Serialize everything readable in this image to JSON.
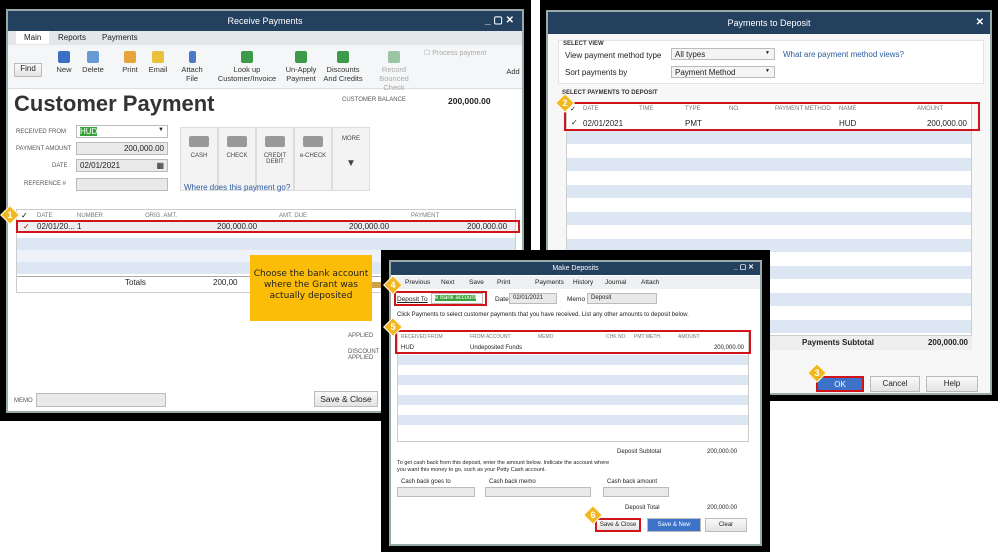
{
  "receive_payments": {
    "title": "Receive Payments",
    "tabs": [
      "Main",
      "Reports",
      "Payments"
    ],
    "toolbar": {
      "find": "Find",
      "new": "New",
      "delete": "Delete",
      "print": "Print",
      "email": "Email",
      "attach": "Attach File",
      "lookup": "Look up Customer/Invoice",
      "unapply": "Un-Apply Payment",
      "discounts": "Discounts And Credits",
      "record_bounced": "Record Bounced Check",
      "process_payment": "Process payment",
      "add": "Add"
    },
    "heading": "Customer Payment",
    "customer_balance_label": "CUSTOMER BALANCE",
    "customer_balance": "200,000.00",
    "received_from_label": "RECEIVED FROM",
    "received_from": "HUD",
    "payment_amount_label": "PAYMENT AMOUNT",
    "payment_amount": "200,000.00",
    "date_label": "DATE",
    "date": "02/01/2021",
    "reference_label": "REFERENCE #",
    "methods": [
      "CASH",
      "CHECK",
      "CREDIT DEBIT",
      "e-CHECK",
      "MORE"
    ],
    "where_link": "Where does this payment go?",
    "columns": [
      "✓",
      "DATE",
      "NUMBER",
      "ORIG. AMT.",
      "AMT. DUE",
      "PAYMENT"
    ],
    "row": {
      "check": "✓",
      "date": "02/01/20...",
      "number": "1",
      "orig": "200,000.00",
      "due": "200,000.00",
      "payment": "200,000.00"
    },
    "totals_label": "Totals",
    "totals_orig": "200,00",
    "applied_label": "APPLIED",
    "discount_label": "DISCOUNT APPLIED",
    "memo_label": "MEMO",
    "save_close": "Save & Close"
  },
  "payments_to_deposit": {
    "title": "Payments to Deposit",
    "select_view": "SELECT VIEW",
    "method_type_label": "View payment method type",
    "method_type": "All types",
    "sort_label": "Sort payments by",
    "sort": "Payment Method",
    "help_link": "What are payment method views?",
    "select_payments": "SELECT PAYMENTS TO DEPOSIT",
    "columns": [
      "✓",
      "DATE",
      "TIME",
      "TYPE",
      "NO.",
      "PAYMENT METHOD",
      "NAME",
      "AMOUNT"
    ],
    "row": {
      "check": "✓",
      "date": "02/01/2021",
      "type": "PMT",
      "name": "HUD",
      "amount": "200,000.00"
    },
    "subtotal_label": "Payments Subtotal",
    "subtotal": "200,000.00",
    "ok": "OK",
    "cancel": "Cancel",
    "help": "Help"
  },
  "make_deposits": {
    "title": "Make Deposits",
    "toolbar": [
      "Previous",
      "Next",
      "Save",
      "Print",
      "Payments",
      "History",
      "Journal",
      "Attach"
    ],
    "deposit_to_label": "Deposit To",
    "deposit_to": "e Bank account",
    "date_label": "Date",
    "date": "02/01/2021",
    "memo_label": "Memo",
    "memo": "Deposit",
    "instructions": "Click Payments to select customer payments that you have received. List any other amounts to deposit below.",
    "columns": [
      "RECEIVED FROM",
      "FROM ACCOUNT",
      "MEMO",
      "CHK NO.",
      "PMT METH.",
      "AMOUNT"
    ],
    "row": {
      "received_from": "HUD",
      "from_account": "Undeposited Funds",
      "amount": "200,000.00"
    },
    "subtotal_label": "Deposit Subtotal",
    "subtotal": "200,000.00",
    "cashback_text": "To get cash back from this deposit, enter the amount below.  Indicate the account where you want this money to go, such as your Petty Cash account.",
    "cashback_goes": "Cash back goes to",
    "cashback_memo": "Cash back memo",
    "cashback_amount": "Cash back amount",
    "total_label": "Deposit Total",
    "total": "200,000.00",
    "save_close": "Save & Close",
    "save_new": "Save & New",
    "clear": "Clear"
  },
  "callout": "Choose the bank account where the Grant was actually deposited",
  "steps": [
    "1",
    "2",
    "3",
    "4",
    "5",
    "6"
  ],
  "colors": {
    "titlebar": "#23405f",
    "highlight": "#d0141c",
    "callout": "#fbbd08",
    "badge": "#f2b71c"
  }
}
